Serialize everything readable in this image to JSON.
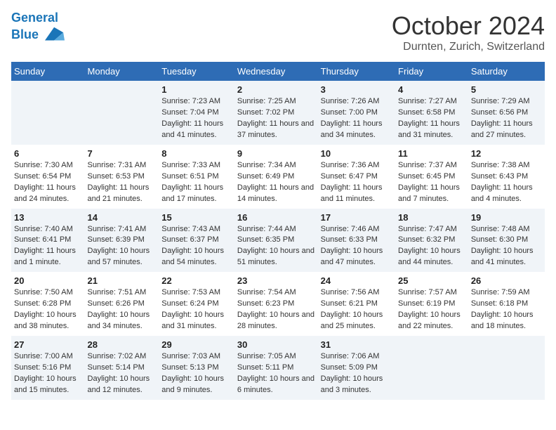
{
  "header": {
    "logo_line1": "General",
    "logo_line2": "Blue",
    "month_title": "October 2024",
    "location": "Durnten, Zurich, Switzerland"
  },
  "weekdays": [
    "Sunday",
    "Monday",
    "Tuesday",
    "Wednesday",
    "Thursday",
    "Friday",
    "Saturday"
  ],
  "weeks": [
    [
      {
        "day": "",
        "info": ""
      },
      {
        "day": "",
        "info": ""
      },
      {
        "day": "1",
        "info": "Sunrise: 7:23 AM\nSunset: 7:04 PM\nDaylight: 11 hours and 41 minutes."
      },
      {
        "day": "2",
        "info": "Sunrise: 7:25 AM\nSunset: 7:02 PM\nDaylight: 11 hours and 37 minutes."
      },
      {
        "day": "3",
        "info": "Sunrise: 7:26 AM\nSunset: 7:00 PM\nDaylight: 11 hours and 34 minutes."
      },
      {
        "day": "4",
        "info": "Sunrise: 7:27 AM\nSunset: 6:58 PM\nDaylight: 11 hours and 31 minutes."
      },
      {
        "day": "5",
        "info": "Sunrise: 7:29 AM\nSunset: 6:56 PM\nDaylight: 11 hours and 27 minutes."
      }
    ],
    [
      {
        "day": "6",
        "info": "Sunrise: 7:30 AM\nSunset: 6:54 PM\nDaylight: 11 hours and 24 minutes."
      },
      {
        "day": "7",
        "info": "Sunrise: 7:31 AM\nSunset: 6:53 PM\nDaylight: 11 hours and 21 minutes."
      },
      {
        "day": "8",
        "info": "Sunrise: 7:33 AM\nSunset: 6:51 PM\nDaylight: 11 hours and 17 minutes."
      },
      {
        "day": "9",
        "info": "Sunrise: 7:34 AM\nSunset: 6:49 PM\nDaylight: 11 hours and 14 minutes."
      },
      {
        "day": "10",
        "info": "Sunrise: 7:36 AM\nSunset: 6:47 PM\nDaylight: 11 hours and 11 minutes."
      },
      {
        "day": "11",
        "info": "Sunrise: 7:37 AM\nSunset: 6:45 PM\nDaylight: 11 hours and 7 minutes."
      },
      {
        "day": "12",
        "info": "Sunrise: 7:38 AM\nSunset: 6:43 PM\nDaylight: 11 hours and 4 minutes."
      }
    ],
    [
      {
        "day": "13",
        "info": "Sunrise: 7:40 AM\nSunset: 6:41 PM\nDaylight: 11 hours and 1 minute."
      },
      {
        "day": "14",
        "info": "Sunrise: 7:41 AM\nSunset: 6:39 PM\nDaylight: 10 hours and 57 minutes."
      },
      {
        "day": "15",
        "info": "Sunrise: 7:43 AM\nSunset: 6:37 PM\nDaylight: 10 hours and 54 minutes."
      },
      {
        "day": "16",
        "info": "Sunrise: 7:44 AM\nSunset: 6:35 PM\nDaylight: 10 hours and 51 minutes."
      },
      {
        "day": "17",
        "info": "Sunrise: 7:46 AM\nSunset: 6:33 PM\nDaylight: 10 hours and 47 minutes."
      },
      {
        "day": "18",
        "info": "Sunrise: 7:47 AM\nSunset: 6:32 PM\nDaylight: 10 hours and 44 minutes."
      },
      {
        "day": "19",
        "info": "Sunrise: 7:48 AM\nSunset: 6:30 PM\nDaylight: 10 hours and 41 minutes."
      }
    ],
    [
      {
        "day": "20",
        "info": "Sunrise: 7:50 AM\nSunset: 6:28 PM\nDaylight: 10 hours and 38 minutes."
      },
      {
        "day": "21",
        "info": "Sunrise: 7:51 AM\nSunset: 6:26 PM\nDaylight: 10 hours and 34 minutes."
      },
      {
        "day": "22",
        "info": "Sunrise: 7:53 AM\nSunset: 6:24 PM\nDaylight: 10 hours and 31 minutes."
      },
      {
        "day": "23",
        "info": "Sunrise: 7:54 AM\nSunset: 6:23 PM\nDaylight: 10 hours and 28 minutes."
      },
      {
        "day": "24",
        "info": "Sunrise: 7:56 AM\nSunset: 6:21 PM\nDaylight: 10 hours and 25 minutes."
      },
      {
        "day": "25",
        "info": "Sunrise: 7:57 AM\nSunset: 6:19 PM\nDaylight: 10 hours and 22 minutes."
      },
      {
        "day": "26",
        "info": "Sunrise: 7:59 AM\nSunset: 6:18 PM\nDaylight: 10 hours and 18 minutes."
      }
    ],
    [
      {
        "day": "27",
        "info": "Sunrise: 7:00 AM\nSunset: 5:16 PM\nDaylight: 10 hours and 15 minutes."
      },
      {
        "day": "28",
        "info": "Sunrise: 7:02 AM\nSunset: 5:14 PM\nDaylight: 10 hours and 12 minutes."
      },
      {
        "day": "29",
        "info": "Sunrise: 7:03 AM\nSunset: 5:13 PM\nDaylight: 10 hours and 9 minutes."
      },
      {
        "day": "30",
        "info": "Sunrise: 7:05 AM\nSunset: 5:11 PM\nDaylight: 10 hours and 6 minutes."
      },
      {
        "day": "31",
        "info": "Sunrise: 7:06 AM\nSunset: 5:09 PM\nDaylight: 10 hours and 3 minutes."
      },
      {
        "day": "",
        "info": ""
      },
      {
        "day": "",
        "info": ""
      }
    ]
  ]
}
